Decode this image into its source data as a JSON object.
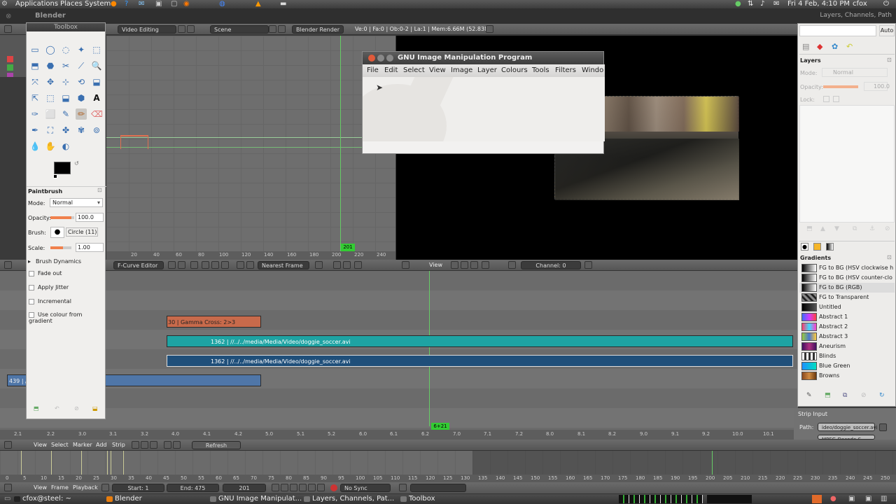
{
  "top_panel": {
    "applications": "Applications",
    "places": "Places",
    "system": "System",
    "datetime": "Fri 4 Feb, 4:10 PM",
    "user": "cfox"
  },
  "blender": {
    "window_title": "Blender",
    "header": {
      "screen": "Video Editing",
      "scene": "Scene",
      "engine": "Blender Render",
      "stats": "Ve:0 | Fa:0 | Ob:0-2 | La:1 | Mem:6.66M (52.83M)"
    },
    "fcurve": {
      "editor": "F-Curve Editor",
      "snap": "Nearest Frame",
      "frame_marker": "201",
      "ticks": [
        "20",
        "40",
        "60",
        "80",
        "100",
        "120",
        "140",
        "160",
        "180",
        "200",
        "220",
        "240"
      ]
    },
    "preview": {
      "view": "View",
      "channel": "Channel: 0"
    },
    "sequencer": {
      "strips": [
        {
          "label": "30 | Gamma Cross: 2>3",
          "color": "#c86a4b"
        },
        {
          "label": "1362 | //../../media/Media/Video/doggie_soccer.avi",
          "color": "#1ea3a3"
        },
        {
          "label": "1362 | //../../media/Media/Video/doggie_soccer.avi",
          "color": "#1f4f7a"
        },
        {
          "label": "439 | //.../watch.avi",
          "color": "#4f76a8"
        }
      ],
      "cursor_label": "6+21",
      "time_ticks": [
        "2.1",
        "2.2",
        "3.0",
        "3.1",
        "3.2",
        "4.0",
        "4.1",
        "4.2",
        "5.0",
        "5.1",
        "5.2",
        "6.0",
        "6.1",
        "6.2",
        "7.0",
        "7.1",
        "7.2",
        "8.0",
        "8.1",
        "8.2",
        "9.0",
        "9.1",
        "9.2",
        "10.0",
        "10.1"
      ],
      "menu": [
        "View",
        "Select",
        "Marker",
        "Add",
        "Strip"
      ],
      "refresh": "Refresh Sequencer",
      "strip_input": "Strip Input",
      "path_label": "Path:",
      "path_value": "ideo/doggie_soccer.avi",
      "extra_field": "MPEG-Decode-S"
    },
    "timeline": {
      "ticks": [
        "0",
        "5",
        "10",
        "15",
        "20",
        "25",
        "30",
        "35",
        "40",
        "45",
        "50",
        "55",
        "60",
        "65",
        "70",
        "75",
        "80",
        "85",
        "90",
        "95",
        "100",
        "105",
        "110",
        "115",
        "120",
        "125",
        "130",
        "135",
        "140",
        "145",
        "150",
        "155",
        "160",
        "165",
        "170",
        "175",
        "180",
        "185",
        "190",
        "195",
        "200",
        "205",
        "210",
        "215",
        "220",
        "225",
        "230",
        "235",
        "240",
        "245",
        "250"
      ],
      "menu": [
        "View",
        "Frame",
        "Playback"
      ],
      "start": "Start: 1",
      "end": "End: 475",
      "current": "201",
      "sync": "No Sync"
    }
  },
  "toolbox": {
    "title": "Toolbox",
    "tool_name": "Paintbrush",
    "mode_label": "Mode:",
    "mode_value": "Normal",
    "opacity_label": "Opacity:",
    "opacity_value": "100.0",
    "brush_label": "Brush:",
    "brush_value": "Circle (11)",
    "scale_label": "Scale:",
    "scale_value": "1.00",
    "brush_dynamics": "Brush Dynamics",
    "options": [
      "Fade out",
      "Apply Jitter",
      "Incremental",
      "Use colour from gradient"
    ]
  },
  "gimp": {
    "title": "GNU Image Manipulation Program",
    "menu": [
      "File",
      "Edit",
      "Select",
      "View",
      "Image",
      "Layer",
      "Colours",
      "Tools",
      "Filters",
      "Windo"
    ]
  },
  "layers_dock": {
    "title": "Layers, Channels, Path",
    "auto": "Auto",
    "layers_label": "Layers",
    "mode_label": "Mode:",
    "mode_value": "Normal",
    "opacity_label": "Opacity:",
    "opacity_value": "100.0",
    "lock_label": "Lock:",
    "gradients_label": "Gradients",
    "gradients": [
      {
        "name": "FG to BG (HSV clockwise h",
        "swatch": "linear-gradient(90deg,#000,#fff)"
      },
      {
        "name": "FG to BG (HSV counter-clo",
        "swatch": "linear-gradient(90deg,#000,#fff)"
      },
      {
        "name": "FG to BG (RGB)",
        "swatch": "linear-gradient(90deg,#000,#fff)"
      },
      {
        "name": "FG to Transparent",
        "swatch": "repeating-linear-gradient(45deg,#888 0 3px,#222 3px 6px)"
      },
      {
        "name": "Untitled",
        "swatch": "linear-gradient(90deg,#000,#555)"
      },
      {
        "name": "Abstract 1",
        "swatch": "linear-gradient(90deg,#3c6cff,#d03cff,#ff4040)"
      },
      {
        "name": "Abstract 2",
        "swatch": "linear-gradient(90deg,#ff3c6e,#3cdcff,#ff3cc8)"
      },
      {
        "name": "Abstract 3",
        "swatch": "linear-gradient(90deg,#9ccc3c,#4a78d0,#ffcc3c)"
      },
      {
        "name": "Aneurism",
        "swatch": "linear-gradient(90deg,#401060,#b03080,#401060)"
      },
      {
        "name": "Blinds",
        "swatch": "repeating-linear-gradient(90deg,#fff 0 3px,#333 3px 6px)"
      },
      {
        "name": "Blue Green",
        "swatch": "linear-gradient(90deg,#1e90ff,#00e0c0)"
      },
      {
        "name": "Browns",
        "swatch": "linear-gradient(90deg,#8a4a20,#d08a40,#6a3a10)"
      }
    ]
  },
  "taskbar": [
    {
      "label": "cfox@steel: ~",
      "icon_color": "#222"
    },
    {
      "label": "Blender",
      "icon_color": "#e87d0d"
    },
    {
      "label": "GNU Image Manipulat...",
      "icon_color": "#777"
    },
    {
      "label": "Layers, Channels, Pat...",
      "icon_color": "#777"
    },
    {
      "label": "Toolbox",
      "icon_color": "#777"
    }
  ]
}
